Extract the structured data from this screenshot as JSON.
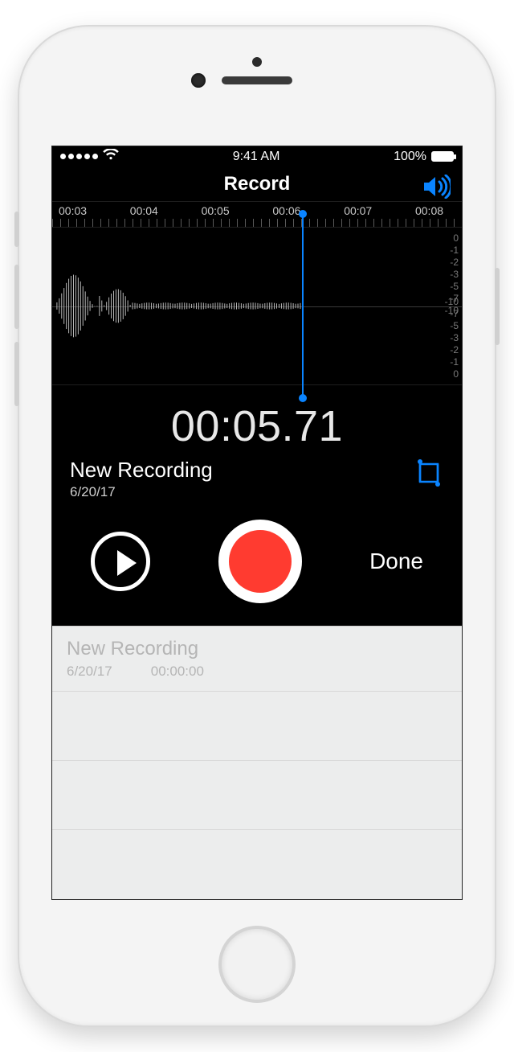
{
  "statusbar": {
    "time": "9:41 AM",
    "battery": "100%"
  },
  "nav": {
    "title": "Record"
  },
  "timeline": {
    "labels": [
      "00:03",
      "00:04",
      "00:05",
      "00:06",
      "00:07",
      "00:08"
    ]
  },
  "db_scale_top": [
    "0",
    "-1",
    "-2",
    "-3",
    "-5",
    "-7",
    "-10"
  ],
  "db_scale_bottom": [
    "-10",
    "-7",
    "-5",
    "-3",
    "-2",
    "-1",
    "0"
  ],
  "counter": "00:05.71",
  "recording": {
    "title": "New Recording",
    "date": "6/20/17"
  },
  "controls": {
    "done": "Done"
  },
  "list": {
    "items": [
      {
        "title": "New Recording",
        "date": "6/20/17",
        "duration": "00:00:00"
      }
    ]
  }
}
